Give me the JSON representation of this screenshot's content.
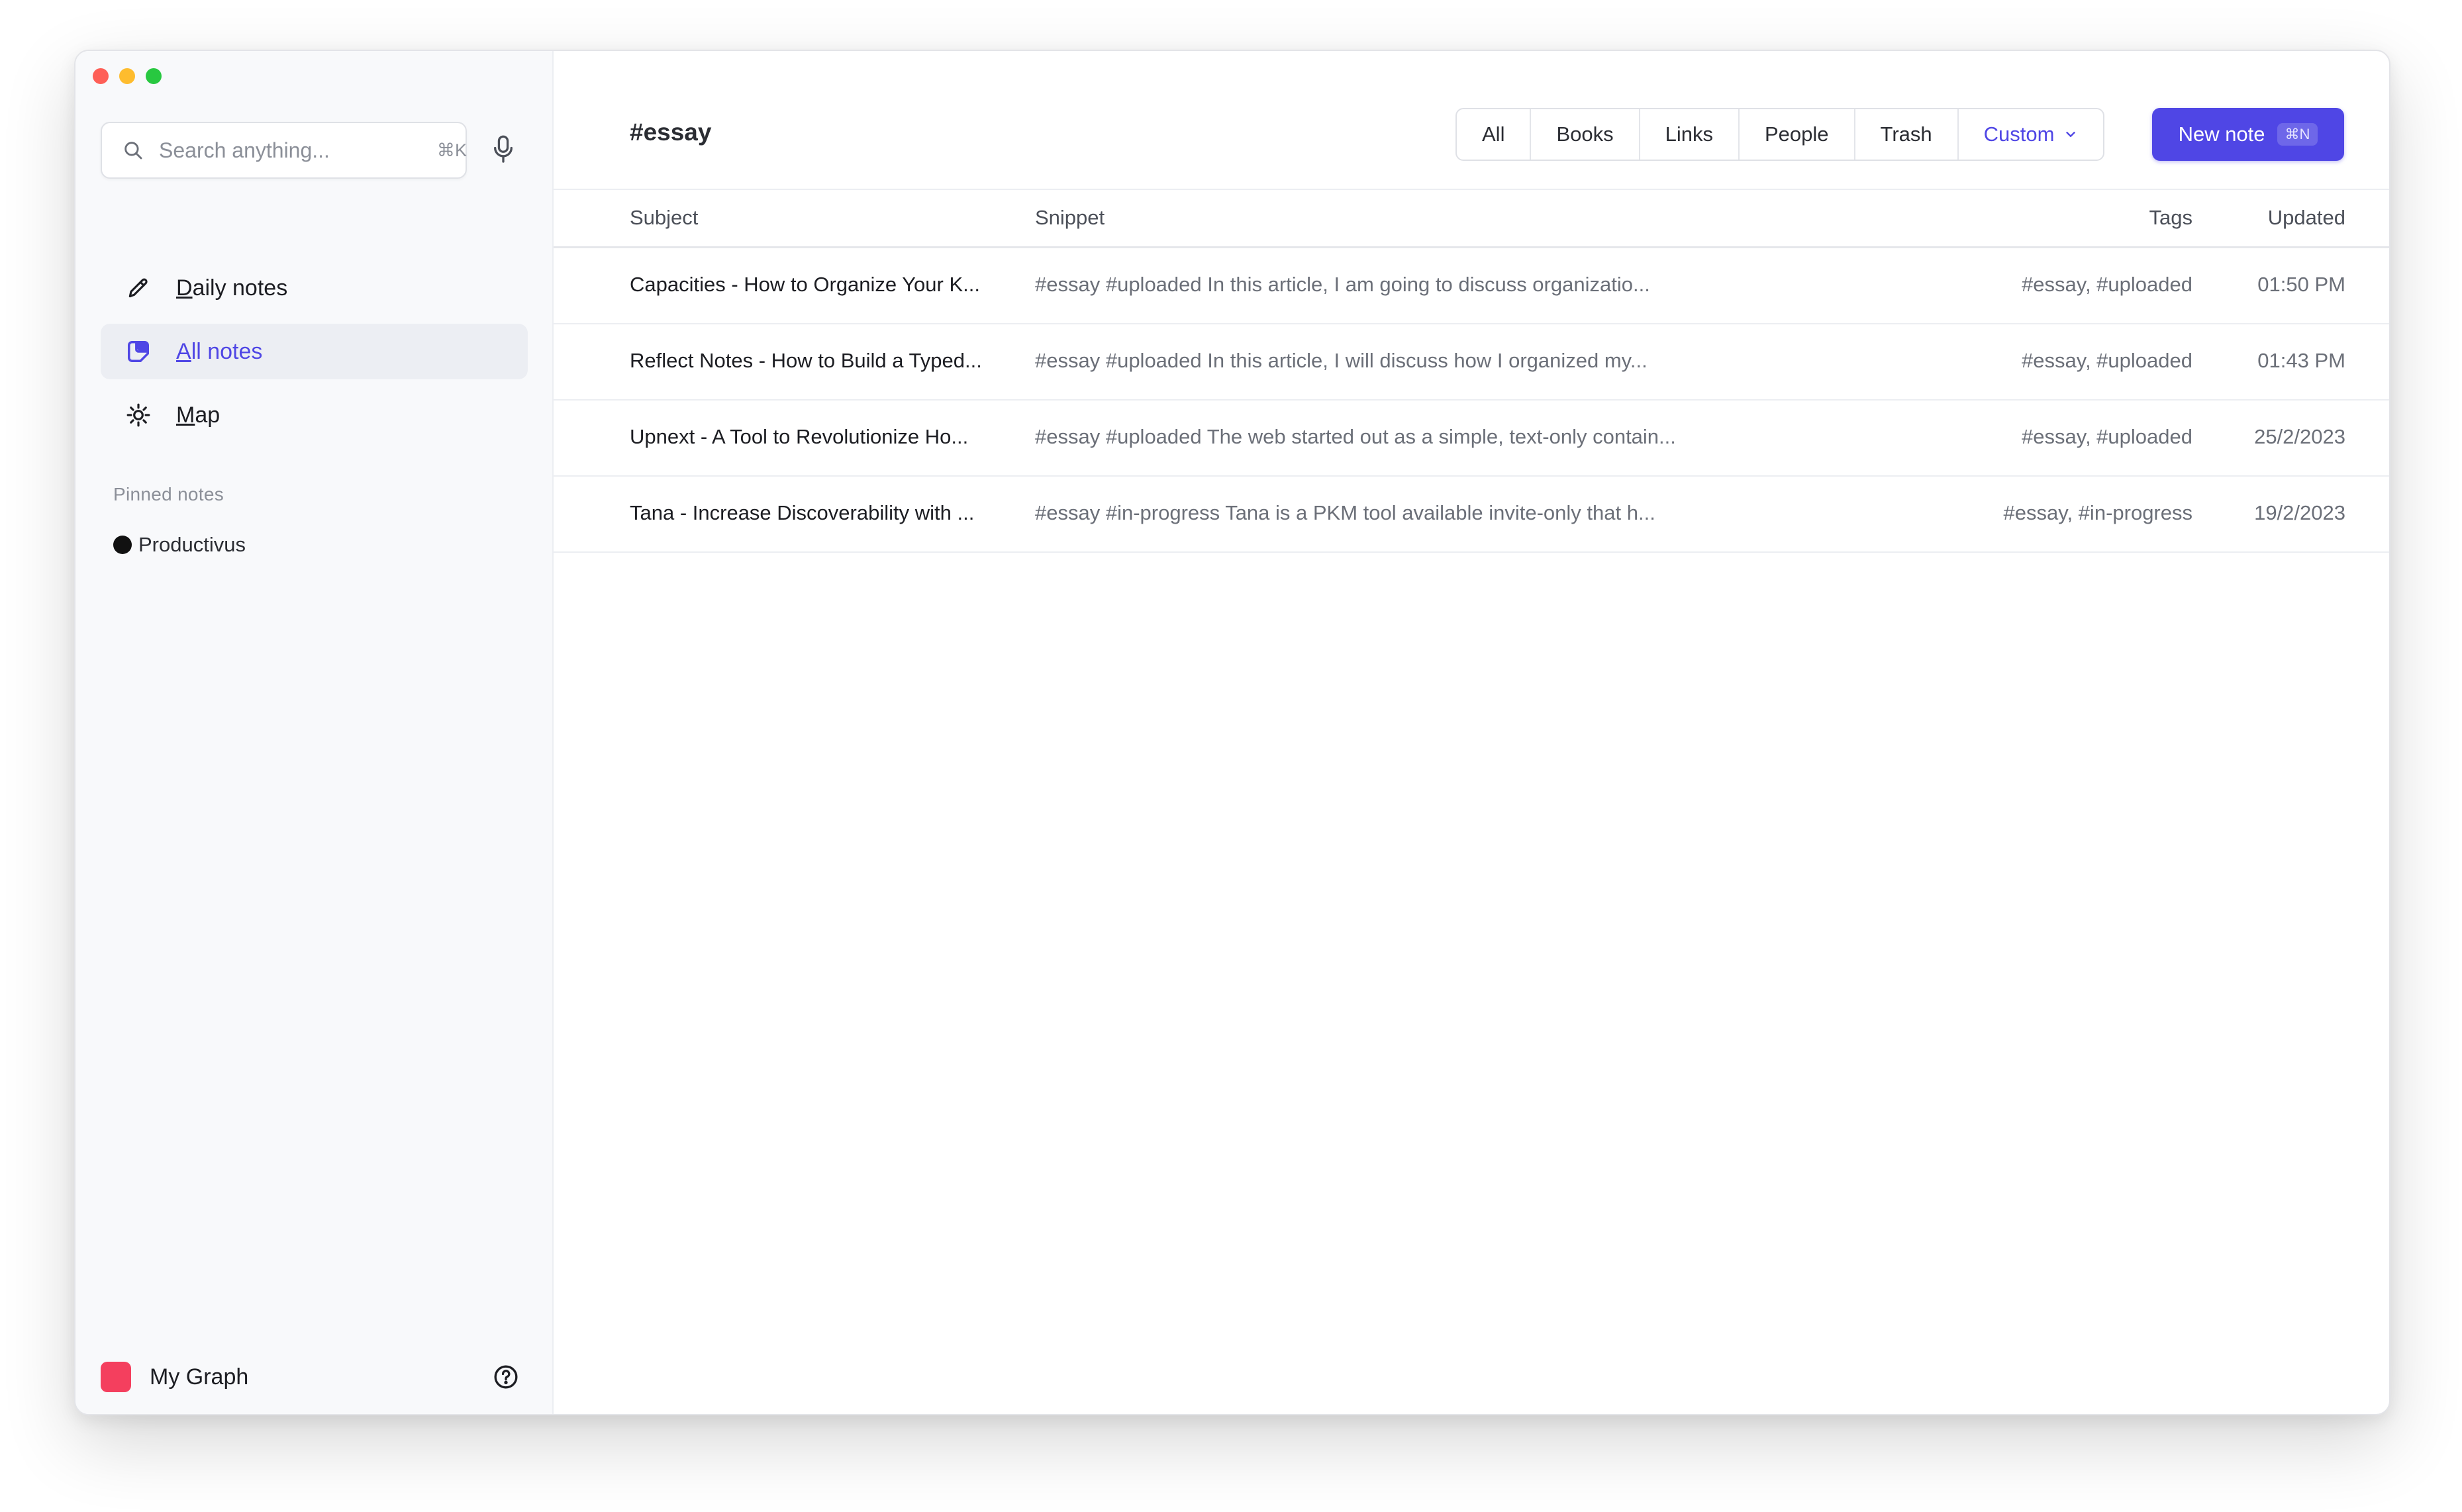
{
  "window": {
    "traffic_colors": [
      "#fe5f57",
      "#febc2e",
      "#28c840"
    ]
  },
  "sidebar": {
    "search": {
      "placeholder": "Search anything...",
      "value": "",
      "shortcut": "⌘K"
    },
    "nav": [
      {
        "label": "Daily notes",
        "icon": "pencil-icon",
        "active": false
      },
      {
        "label": "All notes",
        "icon": "note-icon",
        "active": true
      },
      {
        "label": "Map",
        "icon": "sun-icon",
        "active": false
      }
    ],
    "pinned_title": "Pinned notes",
    "pinned": [
      {
        "label": "Productivus",
        "icon": "black-circle-emoji"
      }
    ],
    "graph": {
      "name": "My Graph",
      "color": "#f43f5e"
    }
  },
  "main": {
    "title": "#essay",
    "filters": [
      "All",
      "Books",
      "Links",
      "People",
      "Trash"
    ],
    "custom_filter": "Custom",
    "new_note": {
      "label": "New note",
      "shortcut": "⌘N",
      "color": "#4f46e5"
    },
    "columns": {
      "subject": "Subject",
      "snippet": "Snippet",
      "tags": "Tags",
      "updated": "Updated"
    },
    "rows": [
      {
        "subject": "Capacities - How to Organize Your K...",
        "snippet": "#essay #uploaded In this article, I am going to discuss organizatio...",
        "tags": "#essay, #uploaded",
        "updated": "01:50 PM"
      },
      {
        "subject": "Reflect Notes - How to Build a Typed...",
        "snippet": "#essay #uploaded In this article, I will discuss how I organized my...",
        "tags": "#essay, #uploaded",
        "updated": "01:43 PM"
      },
      {
        "subject": "Upnext - A Tool to Revolutionize Ho...",
        "snippet": "#essay #uploaded The web started out as a simple, text-only contain...",
        "tags": "#essay, #uploaded",
        "updated": "25/2/2023"
      },
      {
        "subject": "Tana - Increase Discoverability with ...",
        "snippet": "#essay #in-progress Tana is a PKM tool available invite-only that h...",
        "tags": "#essay, #in-progress",
        "updated": "19/2/2023"
      }
    ]
  }
}
